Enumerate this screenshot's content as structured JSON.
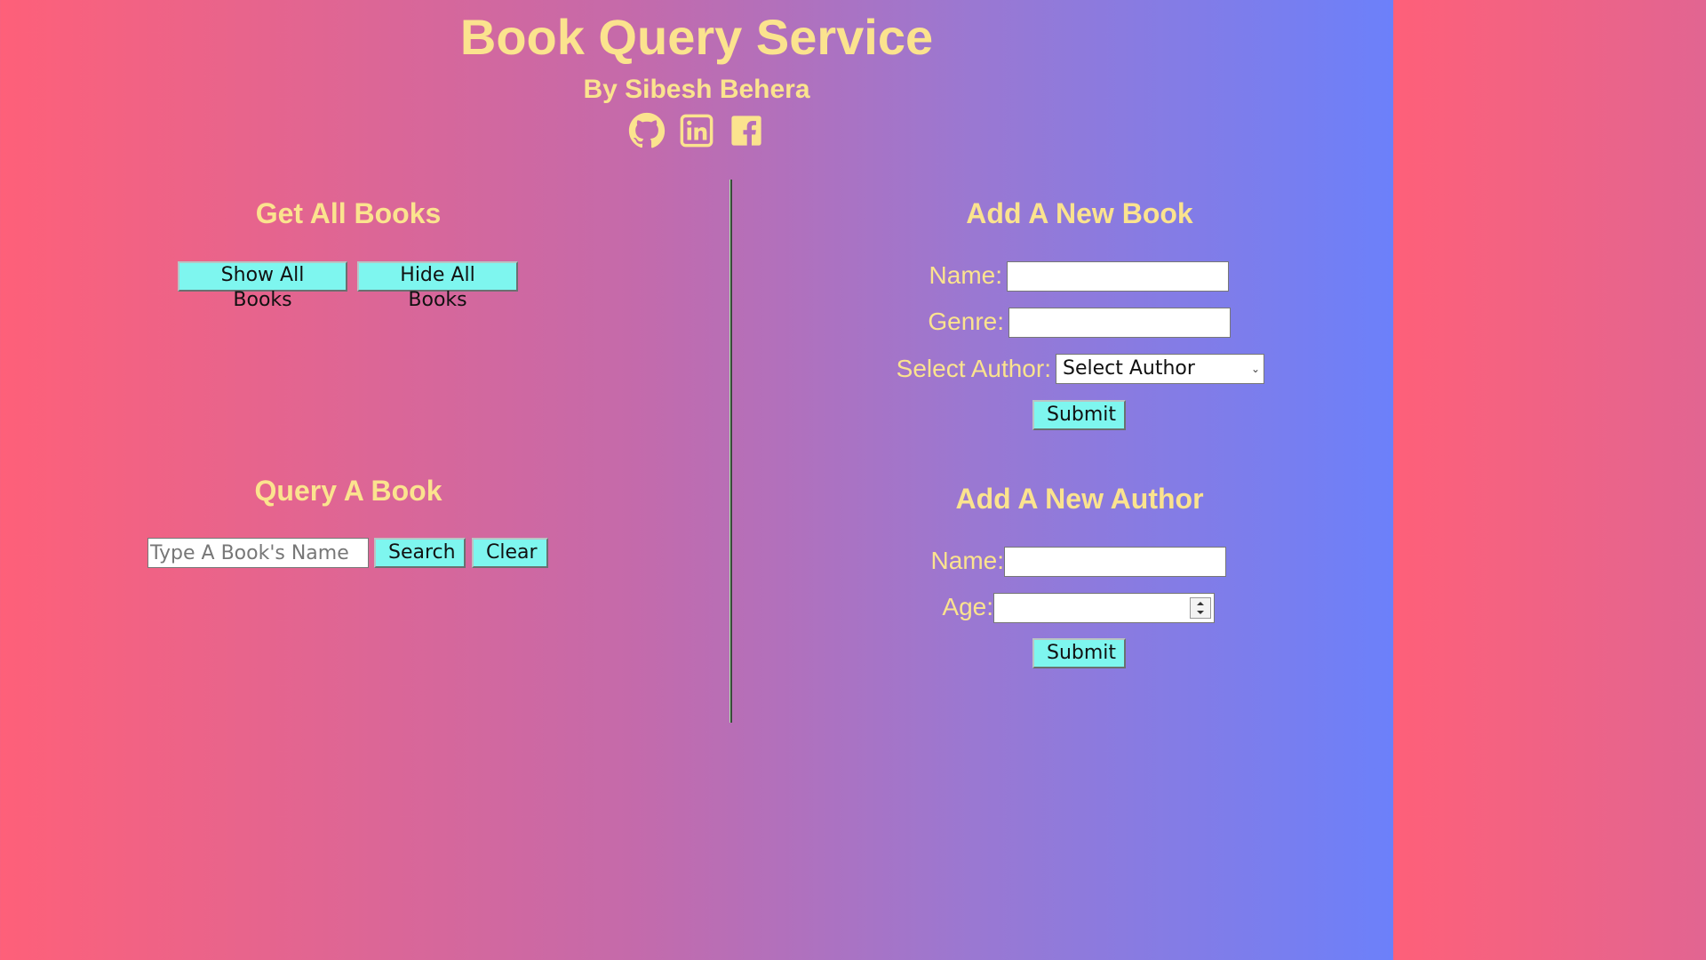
{
  "header": {
    "title": "Book Query Service",
    "subtitle": "By Sibesh Behera",
    "social_icons": [
      "github-icon",
      "linkedin-icon",
      "facebook-icon"
    ]
  },
  "colors": {
    "gradient_start": "#fe6079",
    "gradient_end": "#6c80fa",
    "text_accent": "#fbe38e",
    "button_bg": "#7ef6ef"
  },
  "get_all_books": {
    "title": "Get All Books",
    "show_label": "Show All Books",
    "hide_label": "Hide All Books"
  },
  "query_book": {
    "title": "Query A Book",
    "search_placeholder": "Type A Book's Name",
    "search_value": "",
    "search_label": "Search",
    "clear_label": "Clear"
  },
  "add_book": {
    "title": "Add A New Book",
    "name_label": "Name:",
    "name_value": "",
    "genre_label": "Genre:",
    "genre_value": "",
    "author_label": "Select Author:",
    "author_selected": "Select Author",
    "submit_label": "Submit"
  },
  "add_author": {
    "title": "Add A New Author",
    "name_label": "Name:",
    "name_value": "",
    "age_label": "Age:",
    "age_value": "",
    "submit_label": "Submit"
  }
}
